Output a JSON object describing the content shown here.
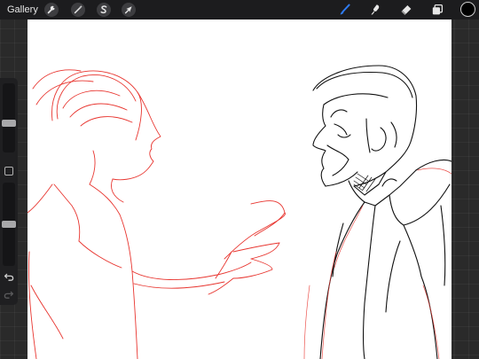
{
  "toolbar": {
    "gallery_label": "Gallery",
    "left_tools": [
      "wrench-icon",
      "magic-wand-icon",
      "selection-icon",
      "transform-arrow-icon"
    ],
    "right_tools": [
      "brush-icon",
      "smudge-icon",
      "eraser-icon",
      "layers-icon"
    ],
    "active_tool": "brush-icon",
    "active_color": "#000000",
    "accent_color": "#2f7cf6"
  },
  "sidebar": {
    "brush_size_level": 0.42,
    "opacity_level": 0.5,
    "modify_icon": "square-modify-icon",
    "undo_icon": "undo-icon",
    "redo_icon": "redo-icon"
  },
  "canvas": {
    "background": "#ffffff",
    "sketch_color": "#e8352f",
    "ink_color": "#111111"
  }
}
